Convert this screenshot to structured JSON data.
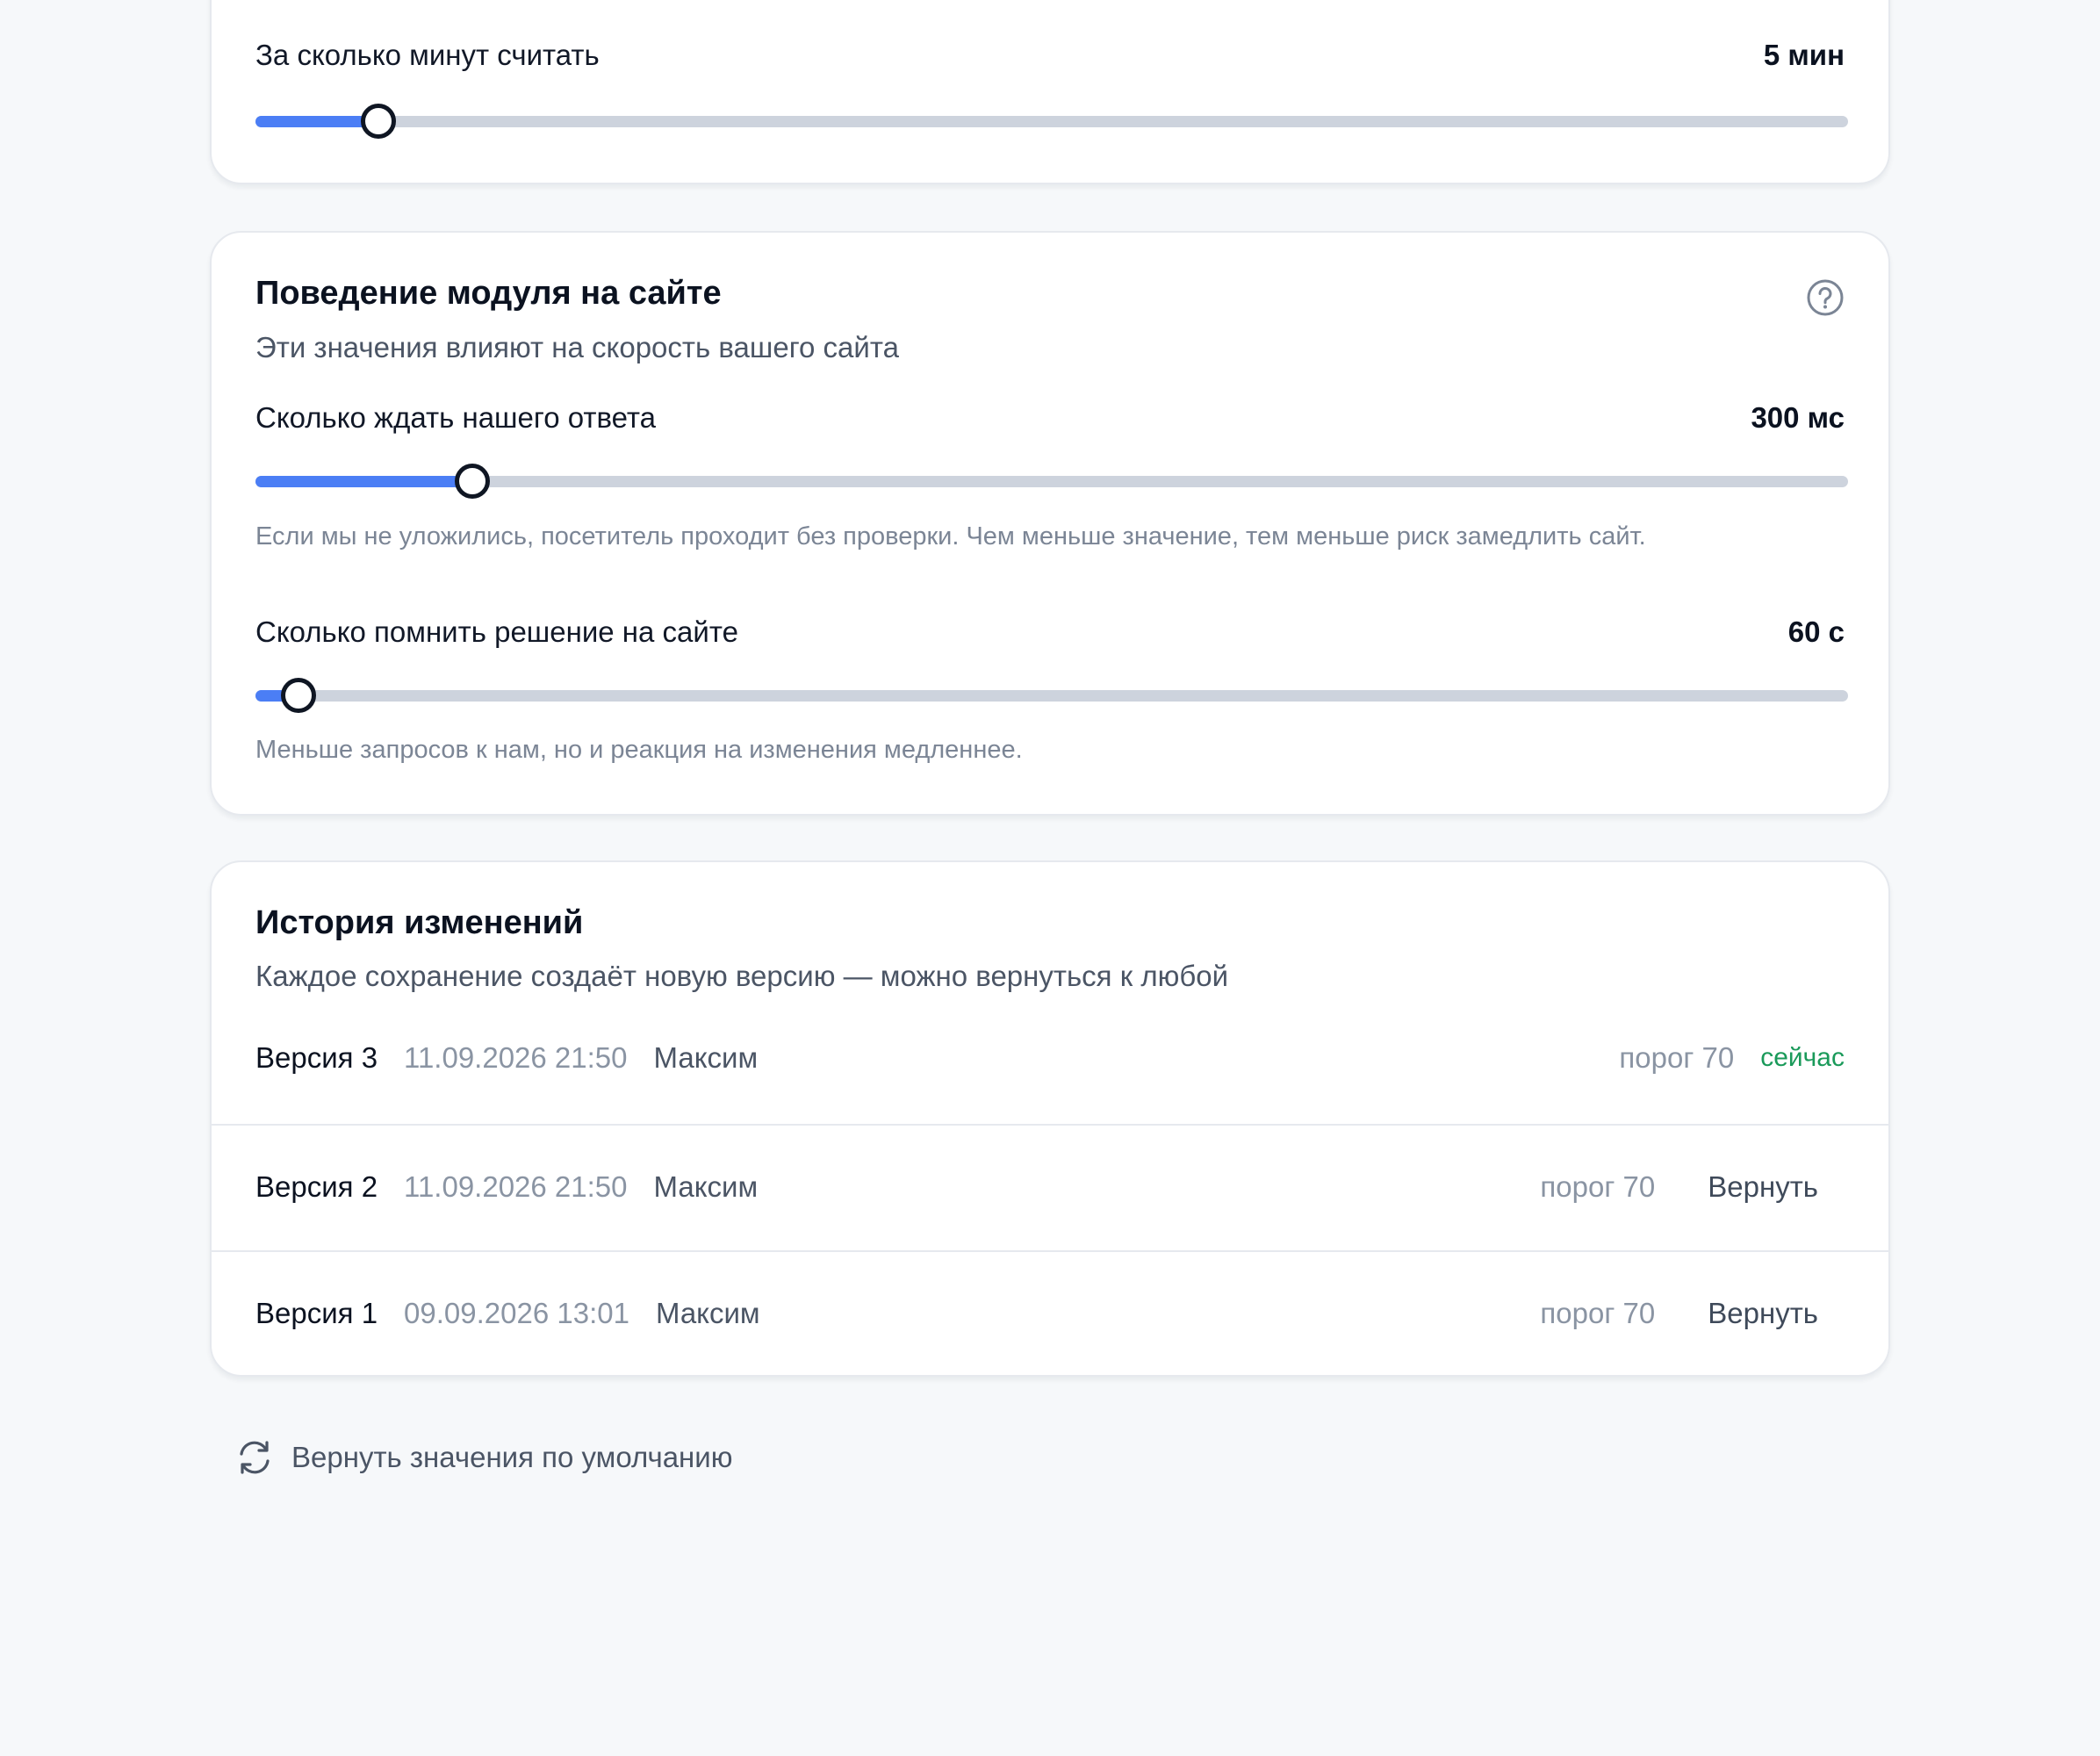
{
  "colors": {
    "accent": "#4b7ef5",
    "track": "#cdd3dd",
    "success": "#1a9a5a",
    "background": "#f6f8fa",
    "card": "#ffffff"
  },
  "counting_card": {
    "label": "За сколько минут считать",
    "value": "5 мин",
    "slider_fraction": 0.077
  },
  "behavior_card": {
    "title": "Поведение модуля на сайте",
    "subtitle": "Эти значения влияют на скорость вашего сайта",
    "help_icon": "question-circle-icon",
    "wait": {
      "label": "Сколько ждать нашего ответа",
      "value": "300 мс",
      "slider_fraction": 0.136,
      "hint": "Если мы не уложились, посетитель проходит без проверки. Чем меньше значение, тем меньше риск замедлить сайт."
    },
    "remember": {
      "label": "Сколько помнить решение на сайте",
      "value": "60 с",
      "slider_fraction": 0.027,
      "hint": "Меньше запросов к нам, но и реакция на изменения медленнее."
    }
  },
  "history_card": {
    "title": "История изменений",
    "subtitle": "Каждое сохранение создаёт новую версию — можно вернуться к любой",
    "rows": [
      {
        "version": "Версия 3",
        "date": "11.09.2026 21:50",
        "user": "Максим",
        "threshold": "порог 70",
        "status": "сейчас"
      },
      {
        "version": "Версия 2",
        "date": "11.09.2026 21:50",
        "user": "Максим",
        "threshold": "порог 70",
        "action": "Вернуть"
      },
      {
        "version": "Версия 1",
        "date": "09.09.2026 13:01",
        "user": "Максим",
        "threshold": "порог 70",
        "action": "Вернуть"
      }
    ]
  },
  "reset": {
    "icon": "refresh-icon",
    "label": "Вернуть значения по умолчанию"
  }
}
